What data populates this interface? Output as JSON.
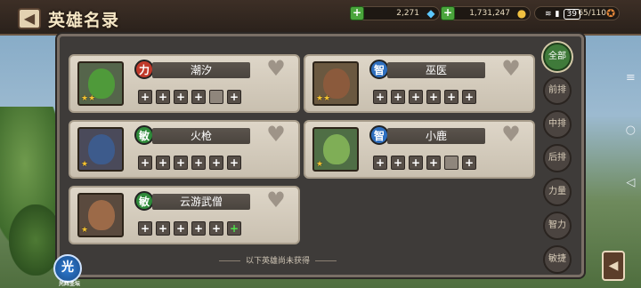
{
  "title": "英雄名录",
  "resources": [
    {
      "value": "2,271",
      "icon": "diamond-icon",
      "color": "#5cc8ff"
    },
    {
      "value": "1,731,247",
      "icon": "gold-icon",
      "color": "#f0c040"
    },
    {
      "value": "65/110",
      "icon": "stamina-icon",
      "color": "#e7893a"
    }
  ],
  "status": {
    "battery": "39"
  },
  "heroes": [
    {
      "name": "潮汐",
      "type": "力",
      "type_color": "#c0392b",
      "stars": "★★",
      "slots": [
        "+",
        "+",
        "+",
        "+",
        "",
        "+"
      ],
      "face_color": "#4f9a3a",
      "bg": "#55654b"
    },
    {
      "name": "巫医",
      "type": "智",
      "type_color": "#2e6fbf",
      "stars": "★★",
      "slots": [
        "+",
        "+",
        "+",
        "+",
        "+",
        "+"
      ],
      "face_color": "#8b5a3c",
      "bg": "#6a5840"
    },
    {
      "name": "火枪",
      "type": "敏",
      "type_color": "#2f8a3a",
      "stars": "★",
      "slots": [
        "+",
        "+",
        "+",
        "+",
        "+",
        "+"
      ],
      "face_color": "#3d5b8c",
      "bg": "#4a4a5a"
    },
    {
      "name": "小鹿",
      "type": "智",
      "type_color": "#2e6fbf",
      "stars": "★",
      "slots": [
        "+",
        "+",
        "+",
        "+",
        "",
        "+"
      ],
      "face_color": "#7fae56",
      "bg": "#4f6e45"
    },
    {
      "name": "云游武僧",
      "type": "敏",
      "type_color": "#2f8a3a",
      "stars": "★",
      "slots": [
        "+",
        "+",
        "+",
        "+",
        "+",
        "+"
      ],
      "face_color": "#9c6a48",
      "bg": "#5a4a3e"
    }
  ],
  "tabs": [
    "全部",
    "前排",
    "中排",
    "后排",
    "力量",
    "智力",
    "敏捷"
  ],
  "footer_text": "以下英雄尚未获得",
  "light_button": {
    "glyph": "光",
    "label": "光辉圣坛"
  },
  "nav": {
    "menu": "≡",
    "home": "○",
    "back": "◁"
  }
}
